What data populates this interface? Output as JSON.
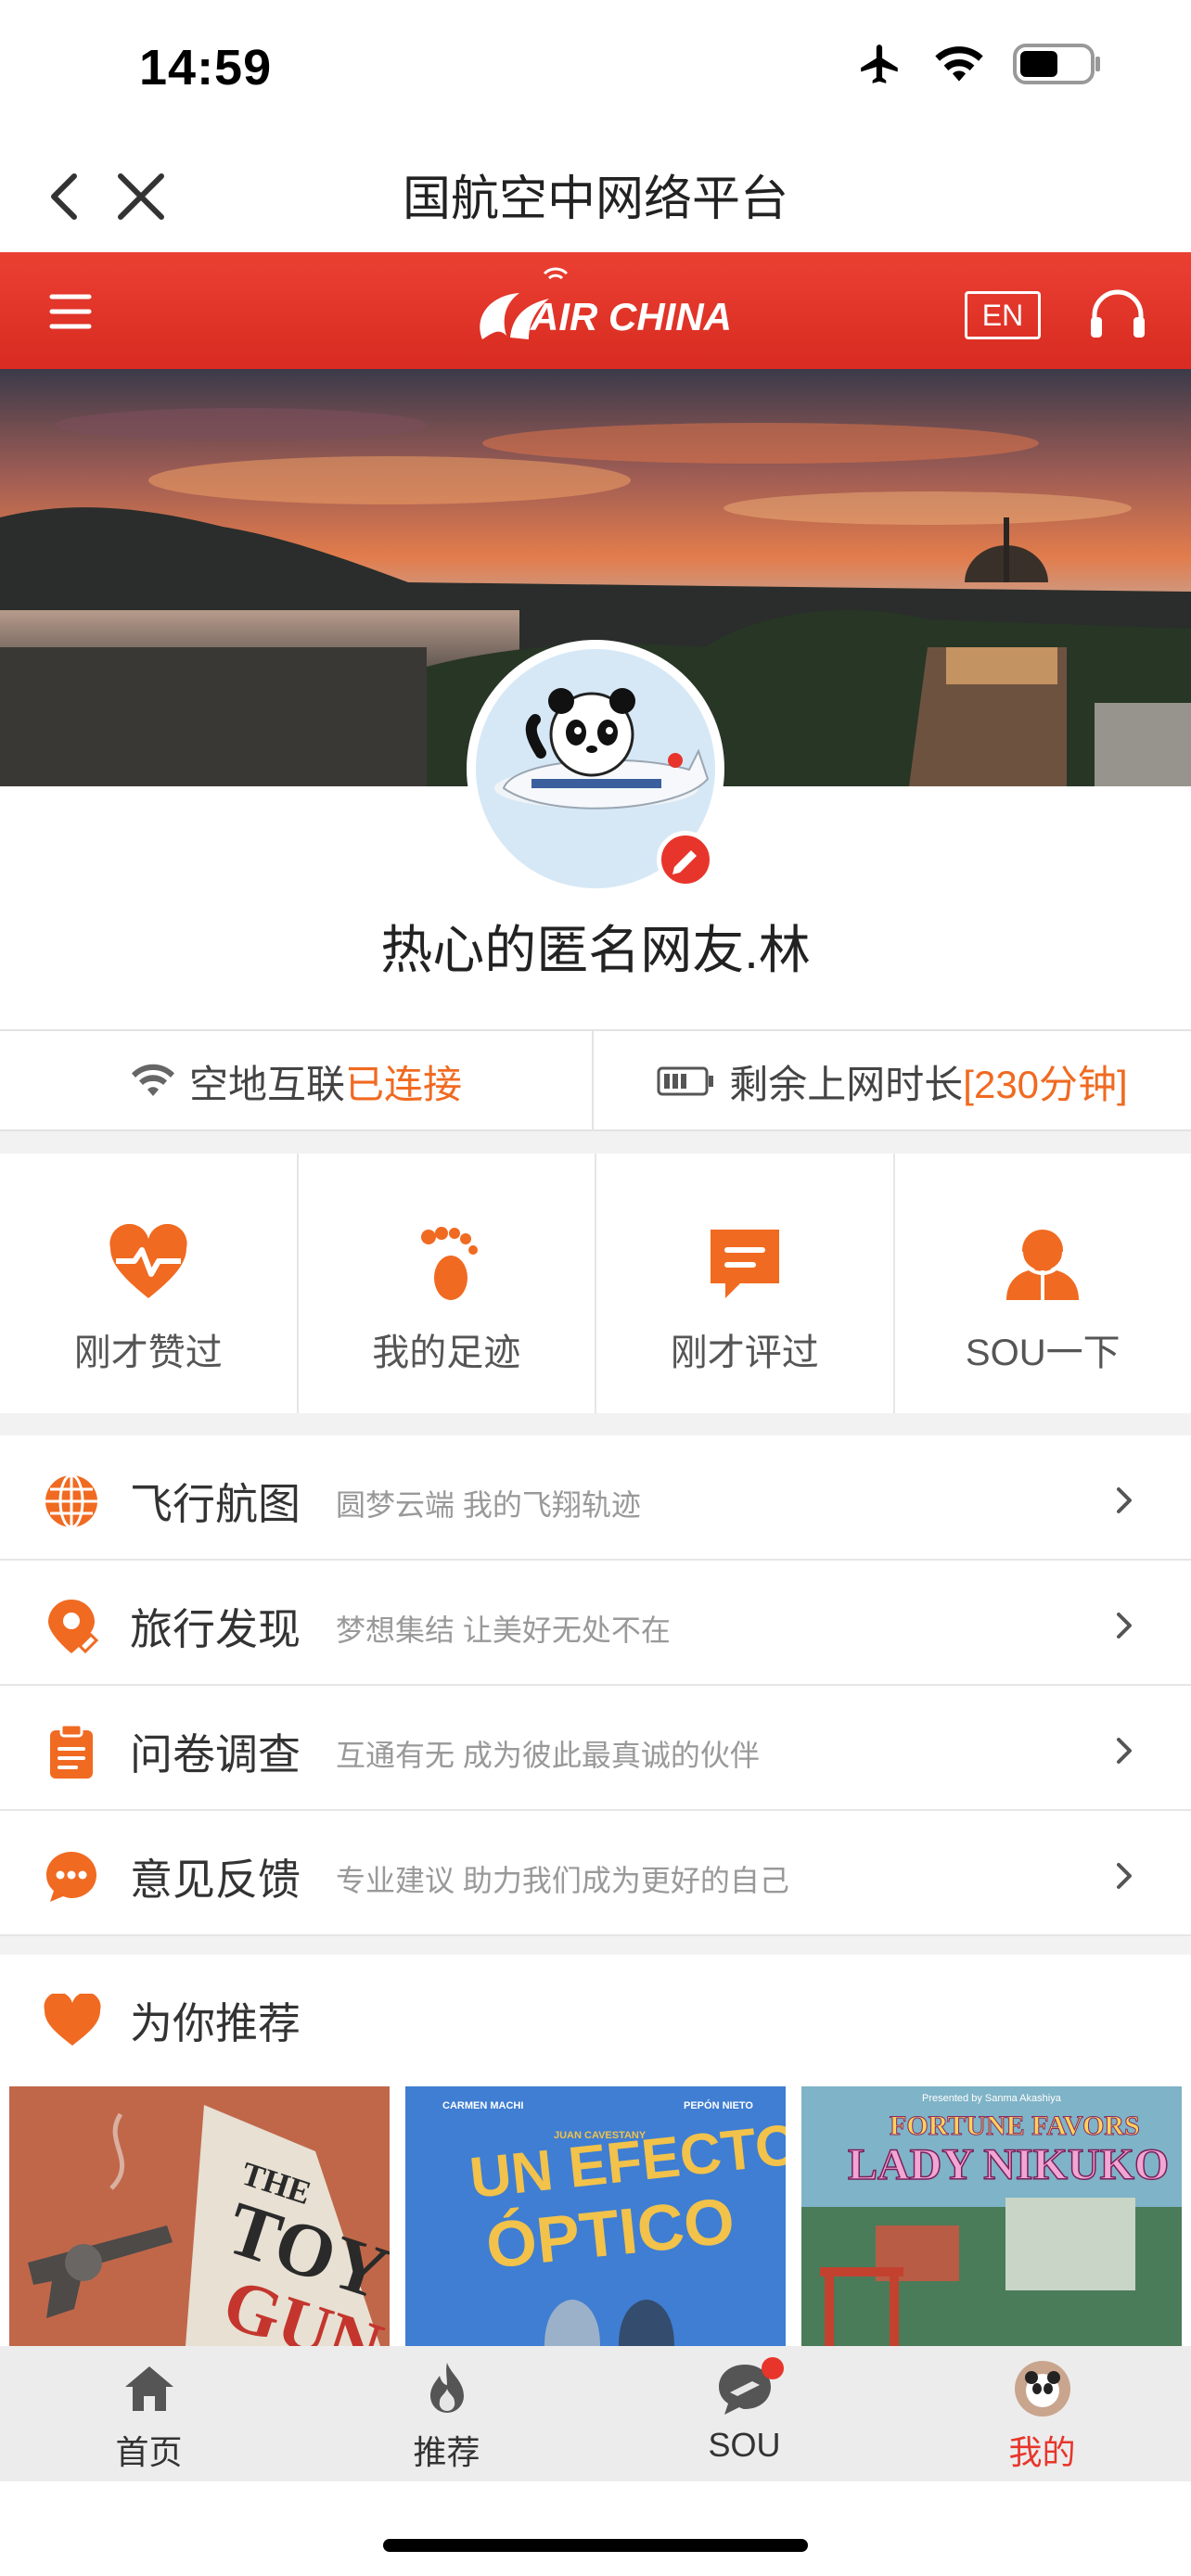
{
  "status_bar": {
    "time": "14:59"
  },
  "nav": {
    "title": "国航空中网络平台"
  },
  "header": {
    "brand": "AIR CHINA",
    "lang_button": "EN"
  },
  "profile": {
    "username": "热心的匿名网友.林"
  },
  "connection": {
    "label": "空地互联",
    "status": "已连接",
    "remaining_label": "剩余上网时长",
    "remaining_value": "[230分钟]"
  },
  "quick_actions": [
    {
      "label": "刚才赞过",
      "icon": "heart-pulse-icon"
    },
    {
      "label": "我的足迹",
      "icon": "footprint-icon"
    },
    {
      "label": "刚才评过",
      "icon": "comment-icon"
    },
    {
      "label": "SOU一下",
      "icon": "people-icon"
    }
  ],
  "menu": [
    {
      "title": "飞行航图",
      "subtitle": "圆梦云端 我的飞翔轨迹",
      "icon": "globe-icon"
    },
    {
      "title": "旅行发现",
      "subtitle": "梦想集结 让美好无处不在",
      "icon": "location-pin-icon"
    },
    {
      "title": "问卷调查",
      "subtitle": "互通有无 成为彼此最真诚的伙伴",
      "icon": "clipboard-icon"
    },
    {
      "title": "意见反馈",
      "subtitle": "专业建议 助力我们成为更好的自己",
      "icon": "chat-bubble-icon"
    }
  ],
  "recommend": {
    "title": "为你推荐",
    "posters": [
      {
        "title_line1": "THE",
        "title_line2": "TOY",
        "title_line3": "GUN"
      },
      {
        "credit_left": "CARMEN MACHI",
        "credit_right": "PEPÓN NIETO",
        "director": "JUAN CAVESTANY",
        "title_line1": "UN EFECTO",
        "title_line2": "ÓPTICO"
      },
      {
        "presenter": "Presented by Sanma Akashiya",
        "title_line1": "FORTUNE FAVORS",
        "title_line2": "LADY NIKUKO"
      }
    ]
  },
  "tabs": [
    {
      "label": "首页",
      "icon": "home-icon"
    },
    {
      "label": "推荐",
      "icon": "flame-icon"
    },
    {
      "label": "SOU",
      "icon": "sou-icon"
    },
    {
      "label": "我的",
      "icon": "profile-avatar-icon"
    }
  ],
  "colors": {
    "brand_red": "#e8352b",
    "accent_orange": "#f06a21"
  }
}
